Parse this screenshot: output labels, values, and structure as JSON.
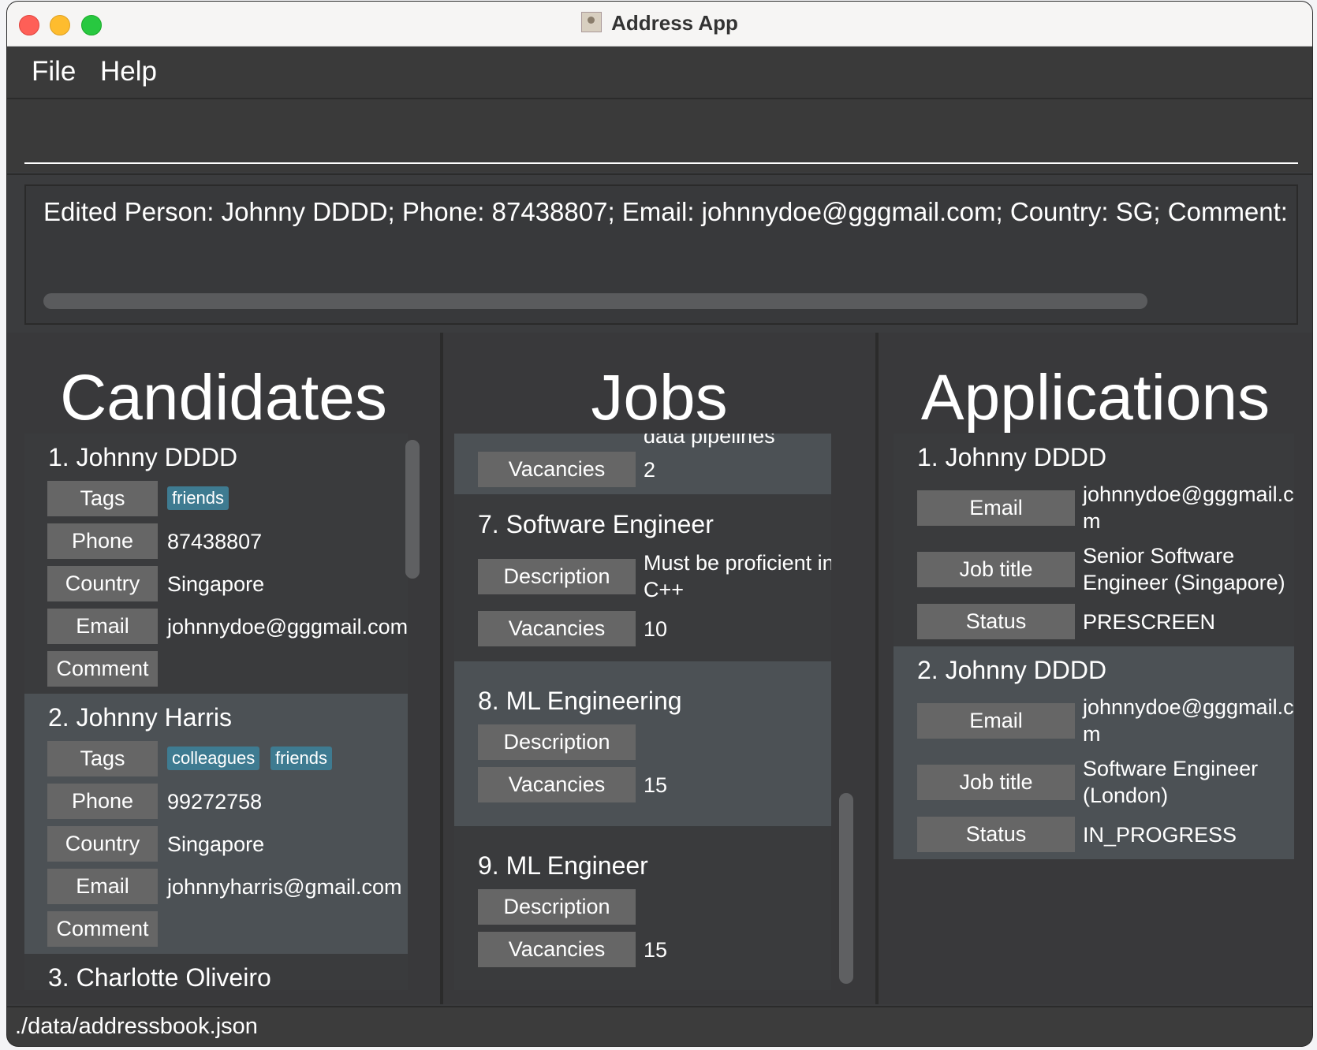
{
  "window": {
    "title": "Address App"
  },
  "menu": {
    "file": "File",
    "help": "Help"
  },
  "command": {
    "value": ""
  },
  "result": {
    "text": "Edited Person: Johnny DDDD; Phone: 87438807; Email: johnnydoe@gggmail.com; Country: SG; Comment: ; T"
  },
  "panels": {
    "candidates": {
      "title": "Candidates",
      "items": [
        {
          "name": "1.  Johnny DDDD",
          "tags_label": "Tags",
          "tags": [
            "friends"
          ],
          "phone_label": "Phone",
          "phone": "87438807",
          "country_label": "Country",
          "country": "Singapore",
          "email_label": "Email",
          "email": "johnnydoe@gggmail.com",
          "comment_label": "Comment"
        },
        {
          "name": "2.  Johnny Harris",
          "tags_label": "Tags",
          "tags": [
            "colleagues",
            "friends"
          ],
          "phone_label": "Phone",
          "phone": "99272758",
          "country_label": "Country",
          "country": "Singapore",
          "email_label": "Email",
          "email": "johnnyharris@gmail.com",
          "comment_label": "Comment"
        },
        {
          "name": "3.  Charlotte Oliveiro"
        }
      ]
    },
    "jobs": {
      "title": "Jobs",
      "items": [
        {
          "partial_description": "data pipelines",
          "vacancies_label": "Vacancies",
          "vacancies": "2"
        },
        {
          "name": "7.  Software Engineer",
          "description_label": "Description",
          "description_line1": "Must be proficient in",
          "description_line2": "C++",
          "vacancies_label": "Vacancies",
          "vacancies": "10"
        },
        {
          "name": "8.  ML Engineering",
          "description_label": "Description",
          "vacancies_label": "Vacancies",
          "vacancies": "15"
        },
        {
          "name": "9.  ML Engineer",
          "description_label": "Description",
          "vacancies_label": "Vacancies",
          "vacancies": "15"
        }
      ]
    },
    "applications": {
      "title": "Applications",
      "items": [
        {
          "name": "1.  Johnny DDDD",
          "email_label": "Email",
          "email_line1": "johnnydoe@gggmail.co",
          "email_line2": "m",
          "job_title_label": "Job title",
          "job_title_line1": "Senior Software",
          "job_title_line2": "Engineer (Singapore)",
          "status_label": "Status",
          "status": "PRESCREEN"
        },
        {
          "name": "2.  Johnny DDDD",
          "email_label": "Email",
          "email_line1": "johnnydoe@gggmail.co",
          "email_line2": "m",
          "job_title_label": "Job title",
          "job_title_line1": "Software Engineer",
          "job_title_line2": "(London)",
          "status_label": "Status",
          "status": "IN_PROGRESS"
        }
      ]
    }
  },
  "status_bar": {
    "path": "./data/addressbook.json"
  },
  "colors": {
    "background": "#3b3c3e",
    "card_alt": "#4c5155",
    "label_bg": "#666666",
    "tag_bg": "#3e7b91"
  }
}
